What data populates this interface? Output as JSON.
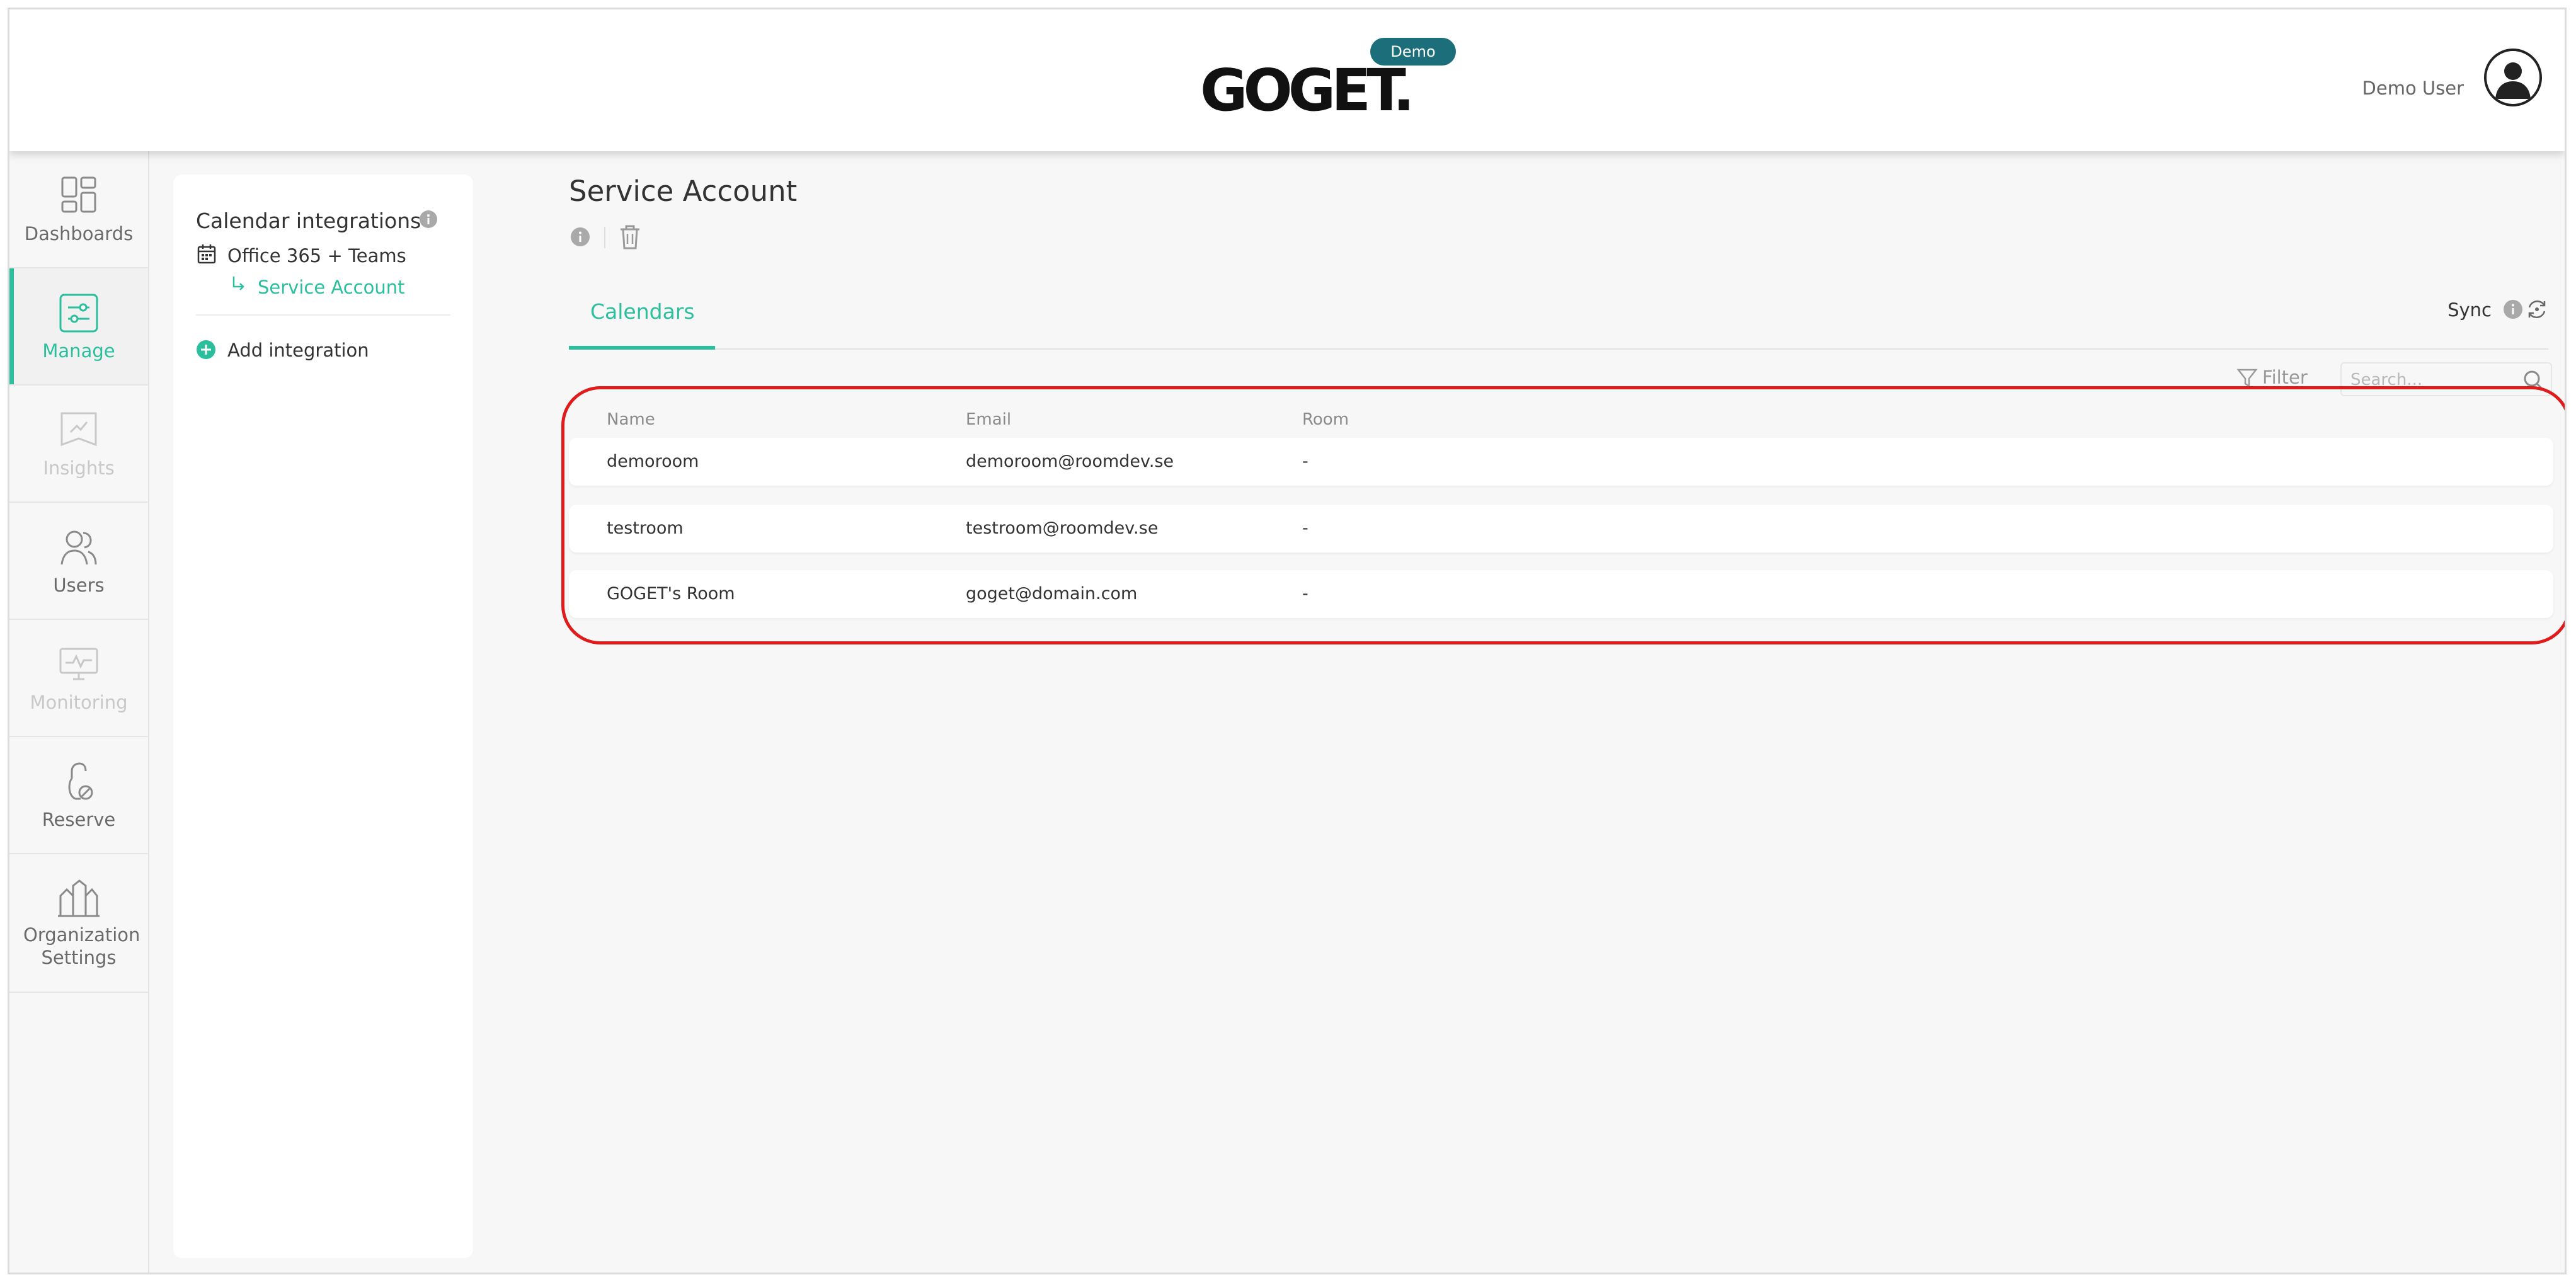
{
  "header": {
    "logo_text": "GOGET.",
    "badge": "Demo",
    "user_name": "Demo User"
  },
  "nav": {
    "items": [
      {
        "label": "Dashboards",
        "icon": "dashboards-icon",
        "state": "normal"
      },
      {
        "label": "Manage",
        "icon": "manage-icon",
        "state": "active"
      },
      {
        "label": "Insights",
        "icon": "insights-icon",
        "state": "disabled"
      },
      {
        "label": "Users",
        "icon": "users-icon",
        "state": "normal"
      },
      {
        "label": "Monitoring",
        "icon": "monitoring-icon",
        "state": "disabled"
      },
      {
        "label": "Reserve",
        "icon": "reserve-icon",
        "state": "normal"
      },
      {
        "label": "Organization Settings",
        "icon": "organization-settings-icon",
        "state": "normal"
      }
    ]
  },
  "integrations": {
    "title": "Calendar integrations",
    "item_label": "Office 365 + Teams",
    "sub_item_label": "Service Account",
    "add_label": "Add integration"
  },
  "main": {
    "title": "Service Account",
    "tab_calendars": "Calendars",
    "sync_label": "Sync",
    "filter_label": "Filter",
    "search_placeholder": "Search..."
  },
  "table": {
    "headers": {
      "name": "Name",
      "email": "Email",
      "room": "Room"
    },
    "rows": [
      {
        "name": "demoroom",
        "email": "demoroom@roomdev.se",
        "room": "-"
      },
      {
        "name": "testroom",
        "email": "testroom@roomdev.se",
        "room": "-"
      },
      {
        "name": "GOGET's Room",
        "email": "goget@domain.com",
        "room": "-"
      }
    ]
  },
  "colors": {
    "accent": "#2bbf9e",
    "badge": "#1c6e7a",
    "highlight": "#e01b1b"
  }
}
